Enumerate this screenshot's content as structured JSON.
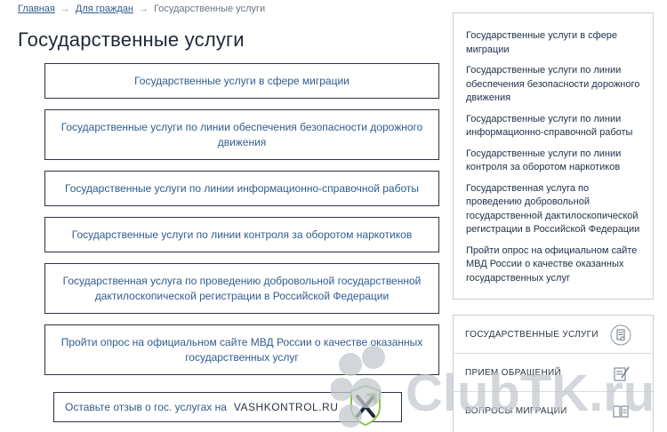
{
  "breadcrumb": {
    "home": "Главная",
    "citizens": "Для граждан",
    "current": "Государственные услуги",
    "separator": "→"
  },
  "page": {
    "title": "Государственные услуги"
  },
  "services": [
    "Государственные услуги в сфере миграции",
    "Государственные услуги по линии обеспечения безопасности дорожного движения",
    "Государственные услуги по линии информационно-справочной работы",
    "Государственные услуги по линии контроля за оборотом наркотиков",
    "Государственная услуга по проведению добровольной государственной дактилоскопической регистрации в Российской Федерации",
    "Пройти опрос на официальном сайте МВД России о качестве оказанных государственных услуг"
  ],
  "feedback": {
    "text": "Оставьте отзыв о гос. услугах на",
    "brand": "VASHKONTROL.RU"
  },
  "sidebar_links": [
    "Государственные услуги в сфере миграции",
    "Государственные услуги по линии обеспечения безопасности дорожного движения",
    "Государственные услуги по линии информационно-справочной работы",
    "Государственные услуги по линии контроля за оборотом наркотиков",
    "Государственная услуга по проведению добровольной государственной дактилоскопической регистрации в Российской Федерации",
    "Пройти опрос на официальном сайте МВД России о качестве оказанных государственных услуг"
  ],
  "sidebar_menu": [
    {
      "label": "ГОСУДАРСТВЕННЫЕ УСЛУГИ",
      "icon": "document-seal-icon"
    },
    {
      "label": "ПРИЕМ ОБРАЩЕНИЙ",
      "icon": "pen-paper-icon"
    },
    {
      "label": "ВОПРОСЫ МИГРАЦИИ",
      "icon": "passport-icon"
    }
  ],
  "watermark": {
    "text": "ClubTK.ru"
  },
  "colors": {
    "link": "#2f5c8f",
    "border": "#2b3440",
    "sidebar_border": "#c9ced6",
    "logo_green": "#8bc34a"
  }
}
